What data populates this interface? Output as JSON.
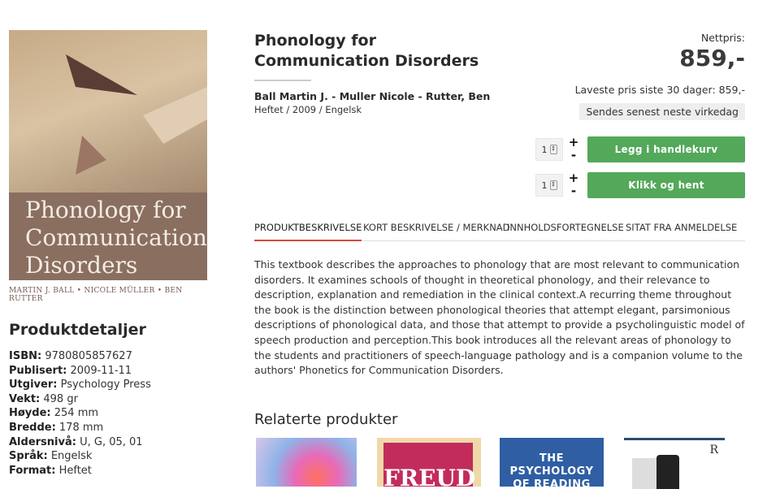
{
  "cover": {
    "title": "Phonology for Communication Disorders",
    "authors_line": "MARTIN J. BALL • NICOLE MÜLLER • BEN RUTTER"
  },
  "details": {
    "heading": "Produktdetaljer",
    "items": [
      {
        "label": "ISBN:",
        "value": "9780805857627"
      },
      {
        "label": "Publisert:",
        "value": "2009-11-11"
      },
      {
        "label": "Utgiver:",
        "value": "Psychology Press"
      },
      {
        "label": "Vekt:",
        "value": "498 gr"
      },
      {
        "label": "Høyde:",
        "value": "254 mm"
      },
      {
        "label": "Bredde:",
        "value": "178 mm"
      },
      {
        "label": "Aldersnivå:",
        "value": "U, G, 05, 01"
      },
      {
        "label": "Språk:",
        "value": "Engelsk"
      },
      {
        "label": "Format:",
        "value": "Heftet"
      }
    ]
  },
  "product": {
    "title": "Phonology for Communication Disorders",
    "authors": "Ball Martin J. - Muller Nicole - Rutter, Ben",
    "format_line": "Heftet / 2009 / Engelsk"
  },
  "price": {
    "net_label": "Nettpris:",
    "value": "859,-",
    "lowest": "Laveste pris siste 30 dager: 859,-",
    "shipping": "Sendes senest neste virkedag"
  },
  "purchase": {
    "qty1": "1",
    "qty2": "1",
    "plus": "+",
    "minus": "-",
    "add_to_cart": "Legg i handlekurv",
    "click_collect": "Klikk og hent"
  },
  "tabs": [
    {
      "label": "PRODUKTBESKRIVELSE"
    },
    {
      "label": "KORT BESKRIVELSE / MERKNAD"
    },
    {
      "label": "INNHOLDSFORTEGNELSE"
    },
    {
      "label": "SITAT FRA ANMELDELSE"
    }
  ],
  "description": "This textbook describes the approaches to phonology that are most relevant to communication disorders. It examines schools of thought in theoretical phonology, and their relevance to description, explanation and remediation in the clinical context.A recurring theme throughout the book is the distinction between phonological theories that attempt elegant, parsimonious descriptions of phonological data, and those that attempt to provide a psycholinguistic model of speech production and perception.This book introduces all the relevant areas of phonology to the students and practitioners of speech-language pathology and is a companion volume to the authors' Phonetics for Communication Disorders.",
  "related": {
    "heading": "Relaterte produkter",
    "thumb2_text": "FREUD",
    "thumb3_text": "THE PSYCHOLOGY OF READING",
    "thumb4_logo": "R"
  }
}
